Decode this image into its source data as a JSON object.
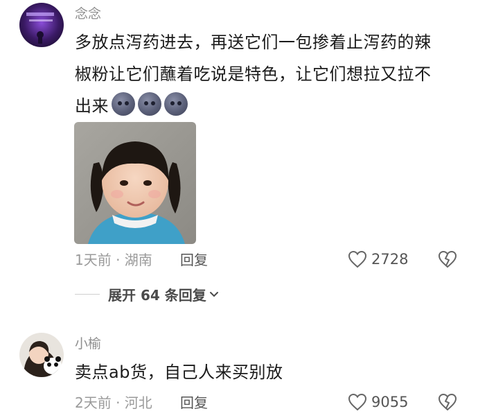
{
  "comments": [
    {
      "username": "念念",
      "text": "多放点泻药进去，再送它们一包掺着止泻药的辣椒粉让它们蘸着吃说是特色，让它们想拉又拉不出来",
      "line1": "多放点泻药进去，再送它们一包掺着止泻药的辣",
      "line2": "椒粉让它们蘸着吃说是特色，让它们想拉又拉不",
      "line3": "出来",
      "emoji_count": 3,
      "emoji_name": "moon-face-emoji",
      "time": "1天前 · 湖南",
      "reply_label": "回复",
      "likes": "2728",
      "expand_label": "展开 64 条回复"
    },
    {
      "username": "小榆",
      "text": "卖点ab货，自己人来买别放",
      "time": "2天前 · 河北",
      "reply_label": "回复",
      "likes": "9055"
    }
  ],
  "icons": {
    "like": "heart-outline-icon",
    "dislike": "broken-heart-icon",
    "expand": "chevron-down-icon"
  },
  "colors": {
    "text": "#1a1a1a",
    "meta": "#9a9a9a",
    "username": "#8e8e8e"
  }
}
